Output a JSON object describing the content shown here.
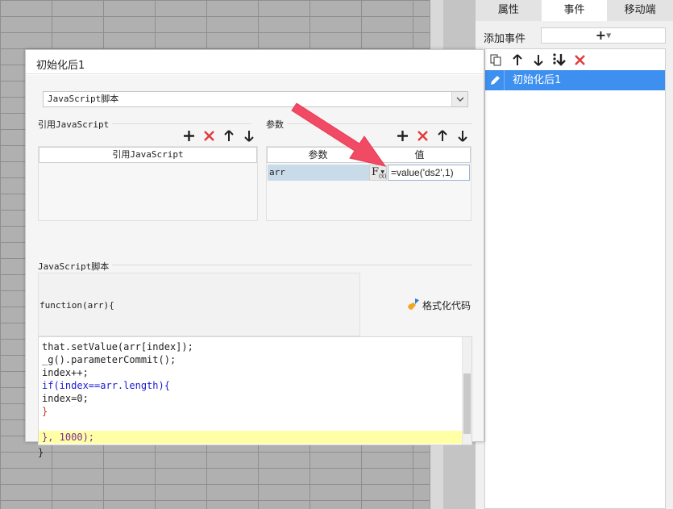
{
  "right_panel": {
    "tabs": [
      {
        "label": "属性",
        "active": false
      },
      {
        "label": "事件",
        "active": true
      },
      {
        "label": "移动端",
        "active": false
      }
    ],
    "add_event_label": "添加事件",
    "add_symbol": "+",
    "events": [
      {
        "label": "初始化后1",
        "selected": true
      }
    ]
  },
  "dialog": {
    "title": "初始化后1",
    "script_type": "JavaScript脚本",
    "ref_section_title": "引用JavaScript",
    "ref_table_header": "引用JavaScript",
    "param_section_title": "参数",
    "param_headers": {
      "name": "参数",
      "value": "值"
    },
    "params": [
      {
        "name": "arr",
        "fx": "F",
        "fx_sub": "(x)",
        "value": "=value('ds2',1)"
      }
    ],
    "script_section_title": "JavaScript脚本",
    "function_header": "function(arr){",
    "format_button": "格式化代码",
    "code_lines": [
      "that.setValue(arr[index]);",
      "_g().parameterCommit();",
      "index++;",
      "if(index==arr.length){",
      "index=0;",
      "}",
      "",
      "}, 1000);"
    ],
    "closing_brace": "}"
  },
  "colors": {
    "accent": "#3d8ff0",
    "delete_red": "#e23b3b",
    "arrow": "#f04a64",
    "highlight_line": "#ffffa6"
  }
}
